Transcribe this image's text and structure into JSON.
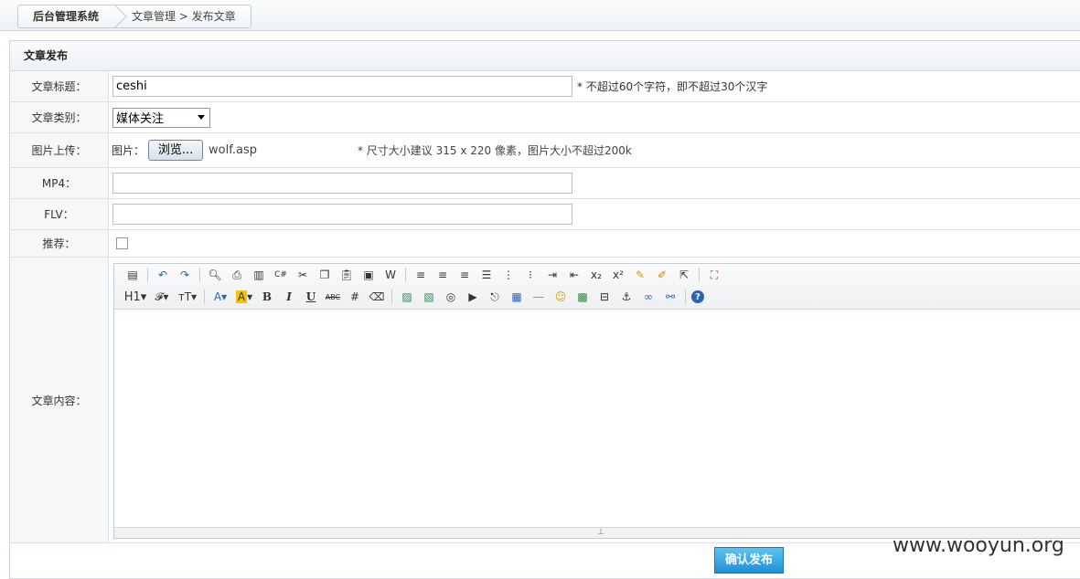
{
  "breadcrumb": {
    "home": "后台管理系统",
    "trail": "文章管理 > 发布文章"
  },
  "panel": {
    "title": "文章发布"
  },
  "form": {
    "title": {
      "label": "文章标题：",
      "value": "ceshi",
      "hint": "* 不超过60个字符，即不超过30个汉字"
    },
    "category": {
      "label": "文章类别：",
      "selected": "媒体关注"
    },
    "image": {
      "label": "图片上传：",
      "prefix": "图片：",
      "browse": "浏览...",
      "file": "wolf.asp",
      "hint": "* 尺寸大小建议 315 x 220 像素，图片大小不超过200k"
    },
    "mp4": {
      "label": "MP4：",
      "value": ""
    },
    "flv": {
      "label": "FLV：",
      "value": ""
    },
    "recommend": {
      "label": "推荐：",
      "checked": false
    },
    "content": {
      "label": "文章内容："
    }
  },
  "toolbar": {
    "row1": [
      "source-icon",
      "undo-icon",
      "redo-icon",
      "preview-icon",
      "print-icon",
      "template-icon",
      "code-icon",
      "cut-icon",
      "copy-icon",
      "paste-icon",
      "paste-plain-icon",
      "paste-word-icon",
      "align-left-icon",
      "align-center-icon",
      "align-right-icon",
      "justify-icon",
      "ordered-list-icon",
      "unordered-list-icon",
      "indent-icon",
      "outdent-icon",
      "subscript-icon",
      "superscript-icon",
      "clear-format-icon",
      "quick-format-icon",
      "select-all-icon",
      "fullscreen-icon"
    ],
    "row2_text": {
      "heading": "H1",
      "font": "𝓕",
      "size": "тT",
      "forecolor": "A",
      "hilite": "A",
      "bold": "B",
      "italic": "I",
      "underline": "U",
      "strike": "ABC"
    }
  },
  "submit": {
    "label": "确认发布"
  },
  "watermark": "www.wooyun.org"
}
